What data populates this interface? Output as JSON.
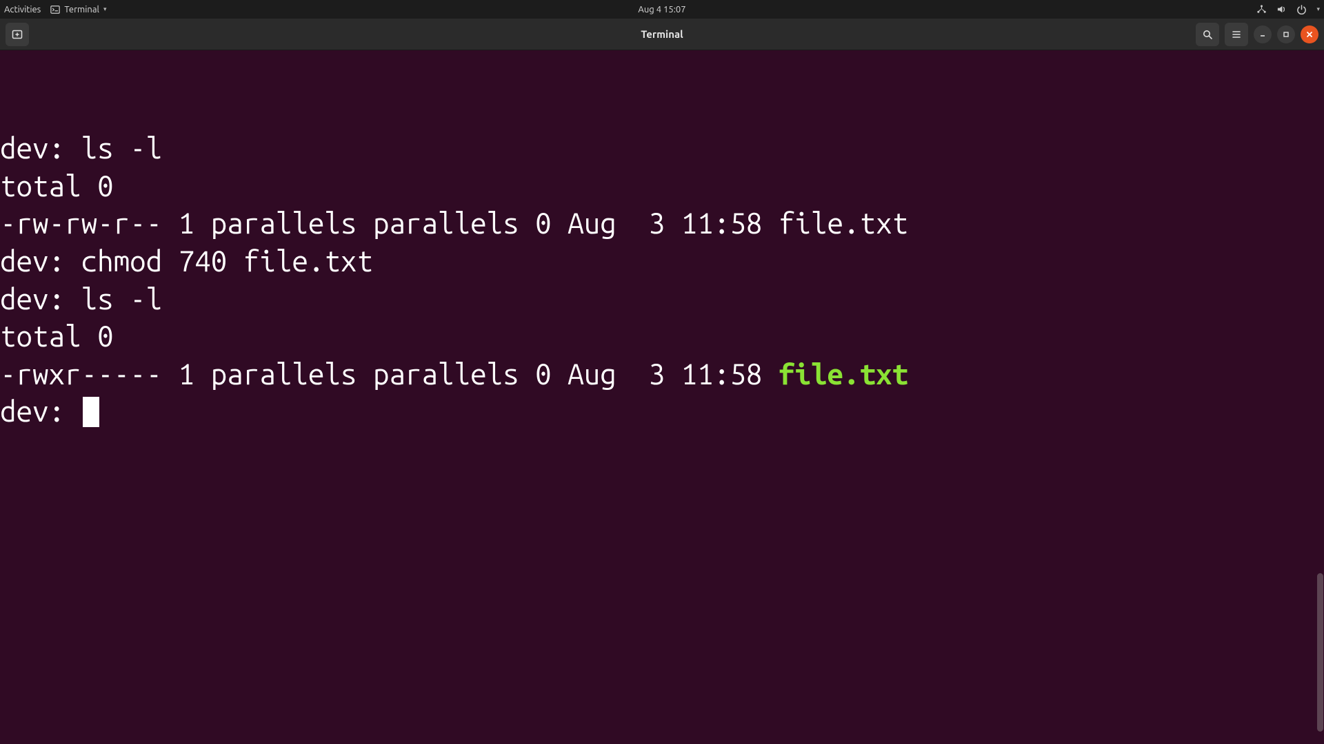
{
  "topbar": {
    "activities": "Activities",
    "app_name": "Terminal",
    "clock": "Aug 4  15:07"
  },
  "window": {
    "title": "Terminal"
  },
  "terminal": {
    "prompt": "dev: ",
    "lines": [
      {
        "prompt": true,
        "text": "ls -l"
      },
      {
        "prompt": false,
        "text": "total 0"
      },
      {
        "prompt": false,
        "text": "-rw-rw-r-- 1 parallels parallels 0 Aug  3 11:58 file.txt"
      },
      {
        "prompt": true,
        "text": "chmod 740 file.txt"
      },
      {
        "prompt": true,
        "text": "ls -l"
      },
      {
        "prompt": false,
        "text": "total 0"
      },
      {
        "prompt": false,
        "text": "-rwxr----- 1 parallels parallels 0 Aug  3 11:58 ",
        "exec": "file.txt"
      },
      {
        "prompt": true,
        "text": "",
        "cursor": true
      }
    ]
  },
  "colors": {
    "term_bg": "#300a24",
    "exec_green": "#8ae234",
    "close_orange": "#e95420"
  }
}
